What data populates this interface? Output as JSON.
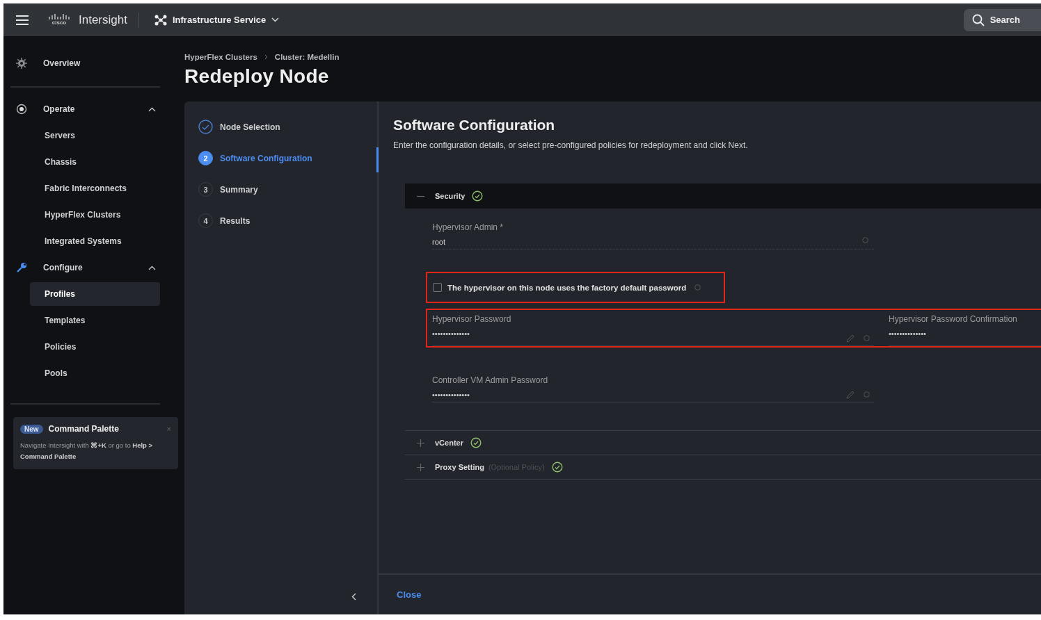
{
  "topbar": {
    "logo_mark": "cisco",
    "product": "Intersight",
    "service": "Infrastructure Service",
    "search": "Search"
  },
  "sidebar": {
    "items": [
      {
        "label": "Overview",
        "kind": "link"
      },
      {
        "label": "Operate",
        "kind": "group",
        "expanded": true,
        "children": [
          {
            "label": "Servers",
            "selected": false
          },
          {
            "label": "Chassis",
            "selected": false
          },
          {
            "label": "Fabric Interconnects",
            "selected": false
          },
          {
            "label": "HyperFlex Clusters",
            "selected": false
          },
          {
            "label": "Integrated Systems",
            "selected": false
          }
        ]
      },
      {
        "label": "Configure",
        "kind": "group",
        "expanded": true,
        "children": [
          {
            "label": "Profiles",
            "selected": true
          },
          {
            "label": "Templates",
            "selected": false
          },
          {
            "label": "Policies",
            "selected": false
          },
          {
            "label": "Pools",
            "selected": false
          }
        ]
      }
    ]
  },
  "command_palette": {
    "badge": "New",
    "title": "Command Palette",
    "close": "×",
    "text": "Navigate Intersight with **⌘+K** or go to **Help > Command Palette**"
  },
  "breadcrumb": [
    "HyperFlex Clusters",
    "Cluster: Medellin"
  ],
  "title": "Redeploy Node",
  "steps": [
    {
      "label": "Node Selection",
      "completed": true,
      "selected": false
    },
    {
      "number": "2",
      "label": "Software Configuration",
      "completed": false,
      "selected": true
    },
    {
      "number": "3",
      "label": "Summary",
      "completed": false,
      "selected": false
    },
    {
      "number": "4",
      "label": "Results",
      "completed": false,
      "selected": false
    }
  ],
  "form": {
    "title": "Software Configuration",
    "description": "Enter the configuration details, or select pre-configured policies for redeployment and click Next.",
    "sections": [
      {
        "title": "Security",
        "expanded": true,
        "valid": true
      },
      {
        "title": "vCenter",
        "expanded": false,
        "valid": true
      },
      {
        "title": "Proxy Setting",
        "note": "(Optional Policy)",
        "expanded": false,
        "valid": true
      }
    ],
    "admin": {
      "label": "Hypervisor Admin *",
      "value": "root"
    },
    "factory_default": {
      "label": "The hypervisor on this node uses the factory default password",
      "checked": false,
      "highlighted": true
    },
    "passwords": {
      "highlighted": true,
      "fields": [
        {
          "label": "Hypervisor Password",
          "value": "••••••••••••••"
        },
        {
          "label": "Hypervisor Password Confirmation",
          "value": "••••••••••••••"
        }
      ]
    },
    "controller": {
      "label": "Controller VM Admin Password",
      "value": "••••••••••••••"
    }
  },
  "footer": {
    "close": "Close"
  }
}
